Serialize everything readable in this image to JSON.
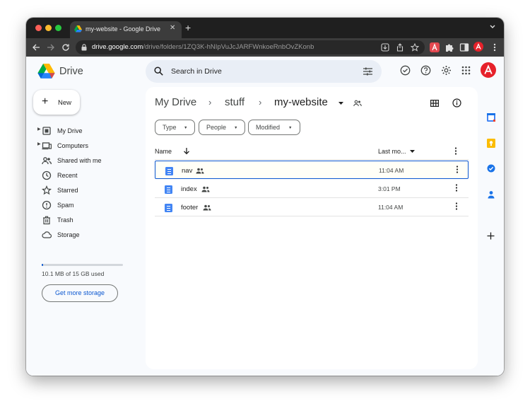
{
  "browser": {
    "tab_title": "my-website - Google Drive",
    "url_host": "drive.google.com",
    "url_path": "/drive/folders/1ZQ3K-hNIpVuJcJARFWnkoeRnbOvZKonb",
    "window_colors": {
      "close": "#fe5f57",
      "minimize": "#febc2e",
      "zoom": "#28c840"
    },
    "extension_colors": {
      "adobe": "#e34850"
    }
  },
  "header": {
    "app_name": "Drive",
    "search_placeholder": "Search in Drive",
    "avatar_color": "#e6212a"
  },
  "sidebar": {
    "new_label": "New",
    "items": [
      {
        "label": "My Drive",
        "icon": "my-drive-icon",
        "expandable": true
      },
      {
        "label": "Computers",
        "icon": "computers-icon",
        "expandable": true
      },
      {
        "label": "Shared with me",
        "icon": "shared-with-me-icon",
        "expandable": false
      },
      {
        "label": "Recent",
        "icon": "recent-icon",
        "expandable": false
      },
      {
        "label": "Starred",
        "icon": "star-icon",
        "expandable": false
      },
      {
        "label": "Spam",
        "icon": "spam-icon",
        "expandable": false
      },
      {
        "label": "Trash",
        "icon": "trash-icon",
        "expandable": false
      },
      {
        "label": "Storage",
        "icon": "cloud-icon",
        "expandable": false
      }
    ],
    "storage_used_text": "10.1 MB of 15 GB used",
    "storage_used_fraction": 0.01,
    "get_more_storage": "Get more storage"
  },
  "main": {
    "breadcrumb": [
      "My Drive",
      "stuff",
      "my-website"
    ],
    "filters": [
      "Type",
      "People",
      "Modified"
    ],
    "columns": {
      "name": "Name",
      "last_modified": "Last mo..."
    },
    "files": [
      {
        "name": "nav",
        "modified": "11:04 AM",
        "selected": true
      },
      {
        "name": "index",
        "modified": "3:01 PM",
        "selected": false
      },
      {
        "name": "footer",
        "modified": "11:04 AM",
        "selected": false
      }
    ],
    "accent": "#0b57d0"
  }
}
